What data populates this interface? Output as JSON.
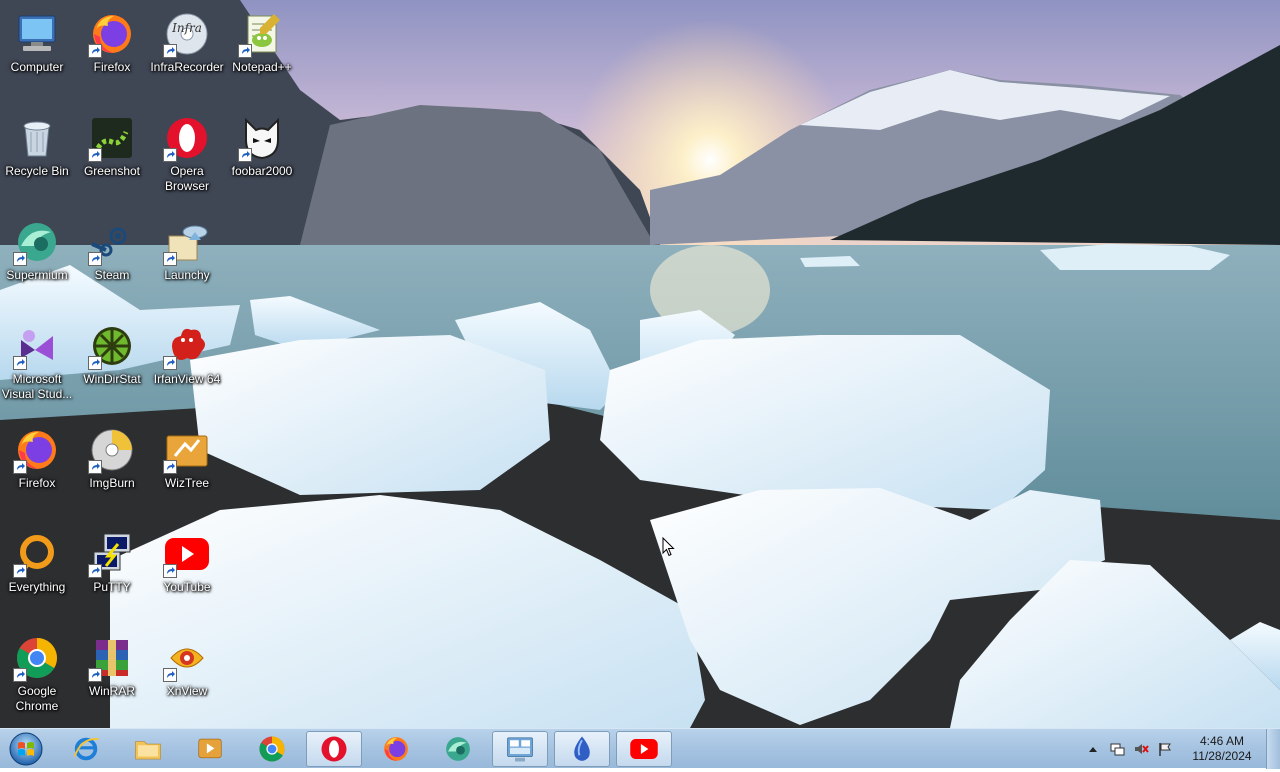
{
  "desktop": {
    "icons": [
      {
        "label": "Computer",
        "icon": "computer-icon",
        "shortcut": false
      },
      {
        "label": "Firefox",
        "icon": "firefox-icon",
        "shortcut": true
      },
      {
        "label": "InfraRecorder",
        "icon": "infrarecorder-icon",
        "shortcut": true
      },
      {
        "label": "Notepad++",
        "icon": "notepadpp-icon",
        "shortcut": true
      },
      {
        "label": "Recycle Bin",
        "icon": "recycle-bin-icon",
        "shortcut": false
      },
      {
        "label": "Greenshot",
        "icon": "greenshot-icon",
        "shortcut": true
      },
      {
        "label": "Opera Browser",
        "icon": "opera-icon",
        "shortcut": true
      },
      {
        "label": "foobar2000",
        "icon": "foobar2000-icon",
        "shortcut": true
      },
      {
        "label": "Supermium",
        "icon": "supermium-icon",
        "shortcut": true
      },
      {
        "label": "Steam",
        "icon": "steam-icon",
        "shortcut": true
      },
      {
        "label": "Launchy",
        "icon": "launchy-icon",
        "shortcut": true
      },
      {
        "label": "Microsoft Visual Stud...",
        "icon": "visual-studio-icon",
        "shortcut": true
      },
      {
        "label": "WinDirStat",
        "icon": "windirstat-icon",
        "shortcut": true
      },
      {
        "label": "IrfanView 64",
        "icon": "irfanview-icon",
        "shortcut": true
      },
      {
        "label": "Firefox",
        "icon": "firefox-icon",
        "shortcut": true
      },
      {
        "label": "ImgBurn",
        "icon": "imgburn-icon",
        "shortcut": true
      },
      {
        "label": "WizTree",
        "icon": "wiztree-icon",
        "shortcut": true
      },
      {
        "label": "Everything",
        "icon": "everything-icon",
        "shortcut": true
      },
      {
        "label": "PuTTY",
        "icon": "putty-icon",
        "shortcut": true
      },
      {
        "label": "YouTube",
        "icon": "youtube-icon",
        "shortcut": true
      },
      {
        "label": "Google Chrome",
        "icon": "chrome-icon",
        "shortcut": true
      },
      {
        "label": "WinRAR",
        "icon": "winrar-icon",
        "shortcut": true
      },
      {
        "label": "XnView",
        "icon": "xnview-icon",
        "shortcut": true
      }
    ]
  },
  "taskbar": {
    "start": {
      "icon": "windows-start-icon"
    },
    "pinned": [
      {
        "name": "internet-explorer",
        "icon": "internet-explorer-icon",
        "active": false
      },
      {
        "name": "file-explorer",
        "icon": "folder-icon",
        "active": false
      },
      {
        "name": "media-player",
        "icon": "media-player-icon",
        "active": false
      },
      {
        "name": "chrome",
        "icon": "chrome-icon",
        "active": false
      },
      {
        "name": "opera",
        "icon": "opera-icon",
        "active": true
      },
      {
        "name": "firefox",
        "icon": "firefox-icon",
        "active": false
      },
      {
        "name": "supermium",
        "icon": "supermium-icon",
        "active": false
      },
      {
        "name": "control-panel",
        "icon": "control-panel-icon",
        "active": true
      },
      {
        "name": "app-drop",
        "icon": "drop-app-icon",
        "active": true
      },
      {
        "name": "youtube",
        "icon": "youtube-icon",
        "active": true
      }
    ],
    "tray": {
      "icons": [
        "chevron-up-icon",
        "network-icon",
        "volume-muted-icon",
        "action-center-flag-icon"
      ],
      "time": "4:46 AM",
      "date": "11/28/2024"
    }
  }
}
